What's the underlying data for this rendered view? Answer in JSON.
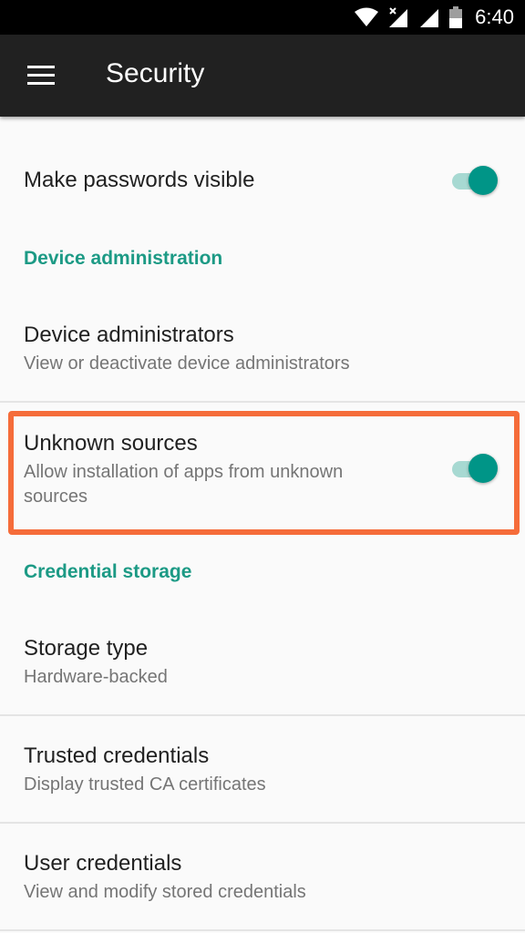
{
  "status_bar": {
    "time": "6:40",
    "icons": [
      "wifi-icon",
      "signal-no-sim-icon",
      "signal-icon",
      "battery-icon"
    ]
  },
  "app_bar": {
    "menu_icon": "menu-icon",
    "title": "Security"
  },
  "settings": {
    "make_passwords_visible": {
      "title": "Make passwords visible",
      "enabled": true
    },
    "device_administration_header": "Device administration",
    "device_administrators": {
      "title": "Device administrators",
      "summary": "View or deactivate device administrators"
    },
    "unknown_sources": {
      "title": "Unknown sources",
      "summary": "Allow installation of apps from unknown sources",
      "enabled": true,
      "highlighted": true
    },
    "credential_storage_header": "Credential storage",
    "storage_type": {
      "title": "Storage type",
      "summary": "Hardware-backed"
    },
    "trusted_credentials": {
      "title": "Trusted credentials",
      "summary": "Display trusted CA certificates"
    },
    "user_credentials": {
      "title": "User credentials",
      "summary": "View and modify stored credentials"
    }
  },
  "colors": {
    "accent": "#009587",
    "header_text": "#1c9a85",
    "highlight_border": "#f56c3a",
    "app_bar": "#212121"
  }
}
